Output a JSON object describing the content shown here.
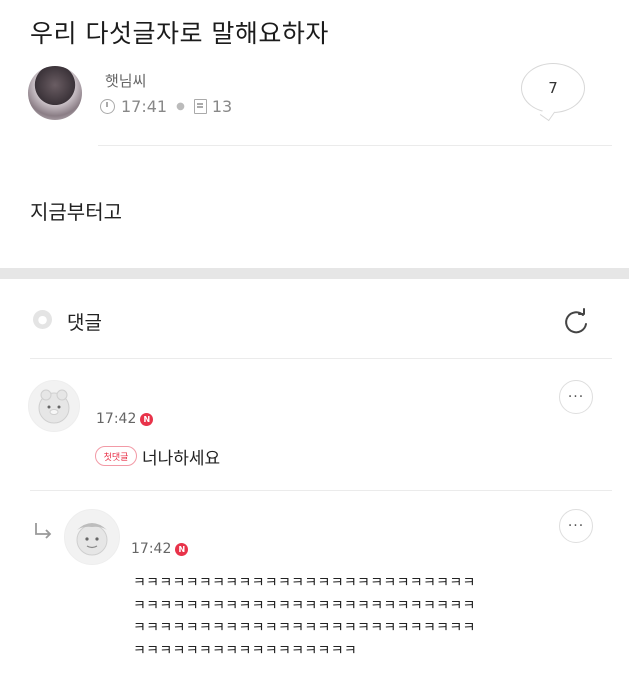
{
  "post": {
    "title": "우리 다섯글자로 말해요하자",
    "author": "햇님씨",
    "time": "17:41",
    "views": "13",
    "comment_count": "7",
    "body": "지금부터고"
  },
  "comments_section": {
    "label": "댓글"
  },
  "comments": [
    {
      "time": "17:42",
      "new_badge": "N",
      "first_badge": "첫댓글",
      "text": "너나하세요",
      "more": "···"
    },
    {
      "time": "17:42",
      "new_badge": "N",
      "text": "ㅋㅋㅋㅋㅋㅋㅋㅋㅋㅋㅋㅋㅋㅋㅋㅋㅋㅋㅋㅋㅋㅋㅋㅋㅋㅋ\nㅋㅋㅋㅋㅋㅋㅋㅋㅋㅋㅋㅋㅋㅋㅋㅋㅋㅋㅋㅋㅋㅋㅋㅋㅋㅋ\nㅋㅋㅋㅋㅋㅋㅋㅋㅋㅋㅋㅋㅋㅋㅋㅋㅋㅋㅋㅋㅋㅋㅋㅋㅋㅋ\nㅋㅋㅋㅋㅋㅋㅋㅋㅋㅋㅋㅋㅋㅋㅋㅋㅋ",
      "more": "···"
    }
  ],
  "colors": {
    "new_badge": "#e8334a",
    "divider": "#e6e6e6"
  }
}
